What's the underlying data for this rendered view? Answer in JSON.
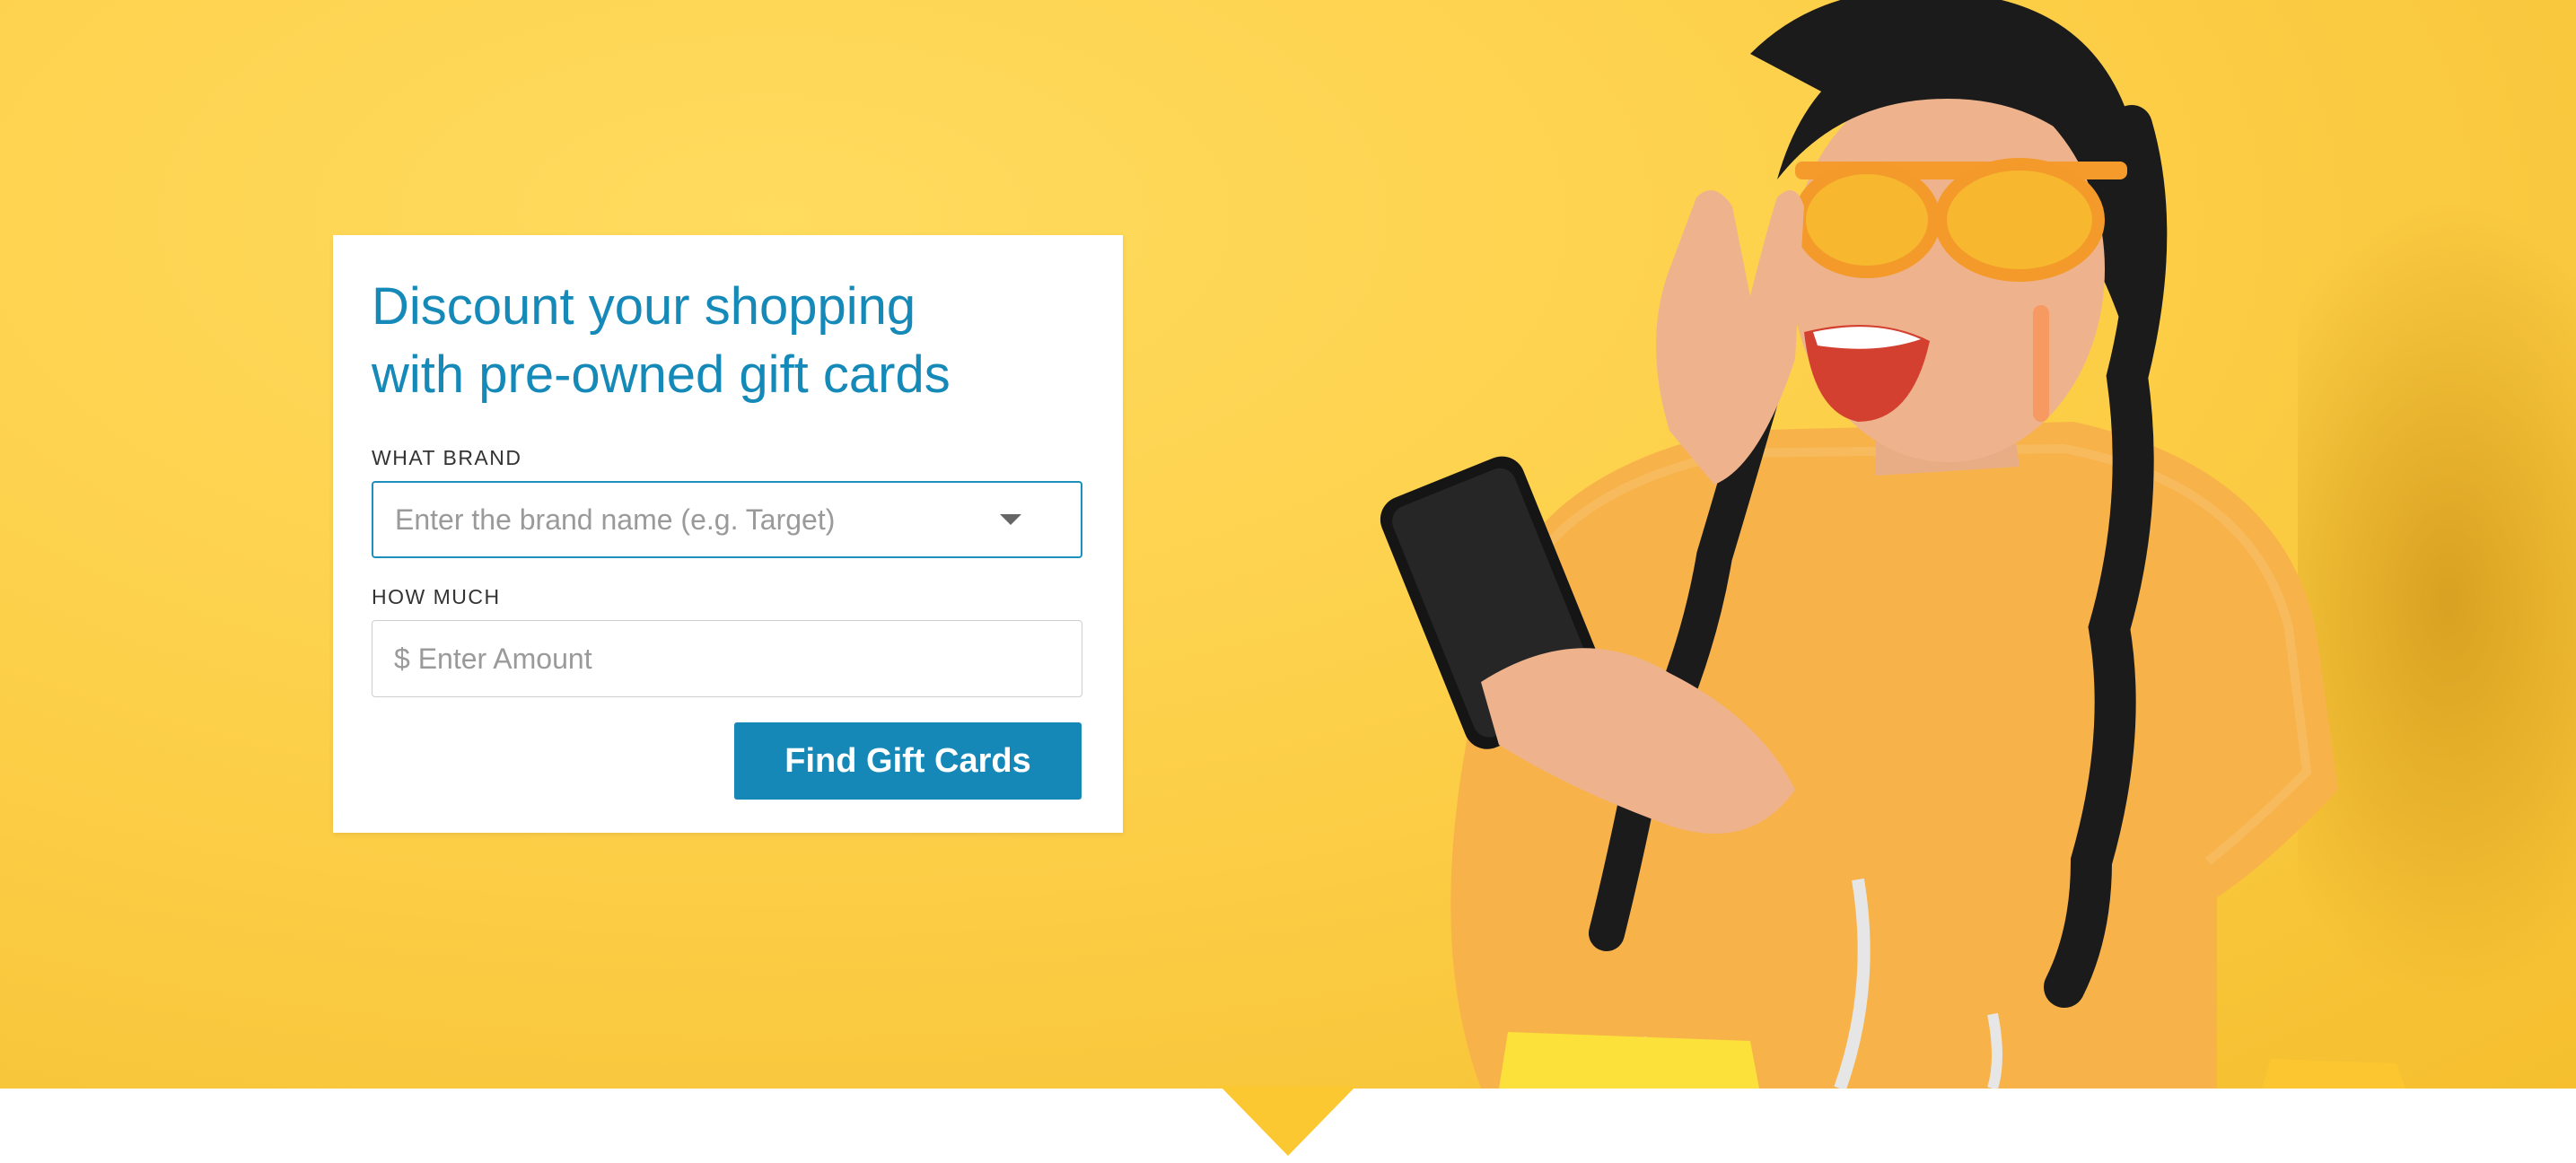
{
  "hero": {
    "title": "Discount your shopping with pre-owned gift cards",
    "background_color": "#fdd04a"
  },
  "form": {
    "brand_label": "WHAT BRAND",
    "brand_placeholder": "Enter the brand name (e.g. Target)",
    "brand_value": "",
    "amount_label": "HOW MUCH",
    "amount_placeholder": "$ Enter Amount",
    "amount_value": "",
    "submit_label": "Find Gift Cards",
    "accent_color": "#1588b8"
  },
  "icons": {
    "brand_dropdown": "chevron-down-icon"
  }
}
